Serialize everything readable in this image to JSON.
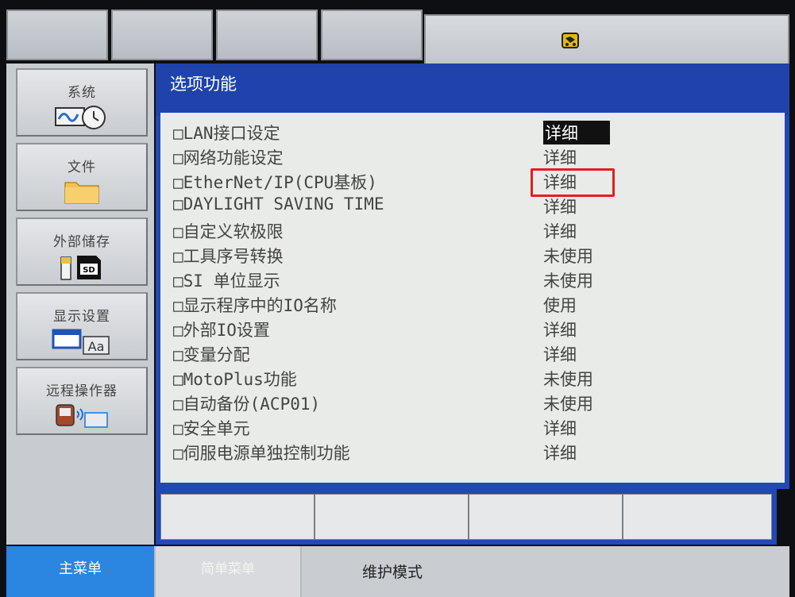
{
  "top_bar": {
    "tabs": [
      "",
      "",
      "",
      ""
    ],
    "robot_icon": "robot-status-icon"
  },
  "sidebar": {
    "items": [
      {
        "label": "系统",
        "icon": "clock-wave-icon"
      },
      {
        "label": "文件",
        "icon": "folder-icon"
      },
      {
        "label": "外部储存",
        "icon": "sd-card-icon"
      },
      {
        "label": "显示设置",
        "icon": "display-font-icon"
      },
      {
        "label": "远程操作器",
        "icon": "remote-pendant-icon"
      }
    ]
  },
  "window": {
    "title": "选项功能",
    "rows": [
      {
        "name": "□LAN接口设定",
        "value": "详细",
        "selected": true
      },
      {
        "name": "□网络功能设定",
        "value": "详细"
      },
      {
        "name": "□EtherNet/IP(CPU基板)",
        "value": "详细",
        "highlighted": true
      },
      {
        "name": "□DAYLIGHT SAVING TIME",
        "value": "详细"
      },
      {
        "name": "□自定义软极限",
        "value": "详细"
      },
      {
        "name": "□工具序号转换",
        "value": "未使用"
      },
      {
        "name": "□SI 单位显示",
        "value": "未使用"
      },
      {
        "name": "□显示程序中的IO名称",
        "value": "使用"
      },
      {
        "name": "□外部IO设置",
        "value": "详细"
      },
      {
        "name": "□变量分配",
        "value": "详细"
      },
      {
        "name": "□MotoPlus功能",
        "value": "未使用"
      },
      {
        "name": "□自动备份(ACP01)",
        "value": "未使用"
      },
      {
        "name": "□安全单元",
        "value": "详细"
      },
      {
        "name": "□伺服电源单独控制功能",
        "value": "详细"
      }
    ]
  },
  "softkeys": [
    "",
    "",
    "",
    ""
  ],
  "bottom": {
    "main_menu": "主菜单",
    "simple_menu": "简单菜单",
    "mode": "维护模式"
  },
  "colors": {
    "window_blue": "#2148b6",
    "main_menu_blue": "#2a86e0",
    "highlight_red": "#e02020"
  }
}
